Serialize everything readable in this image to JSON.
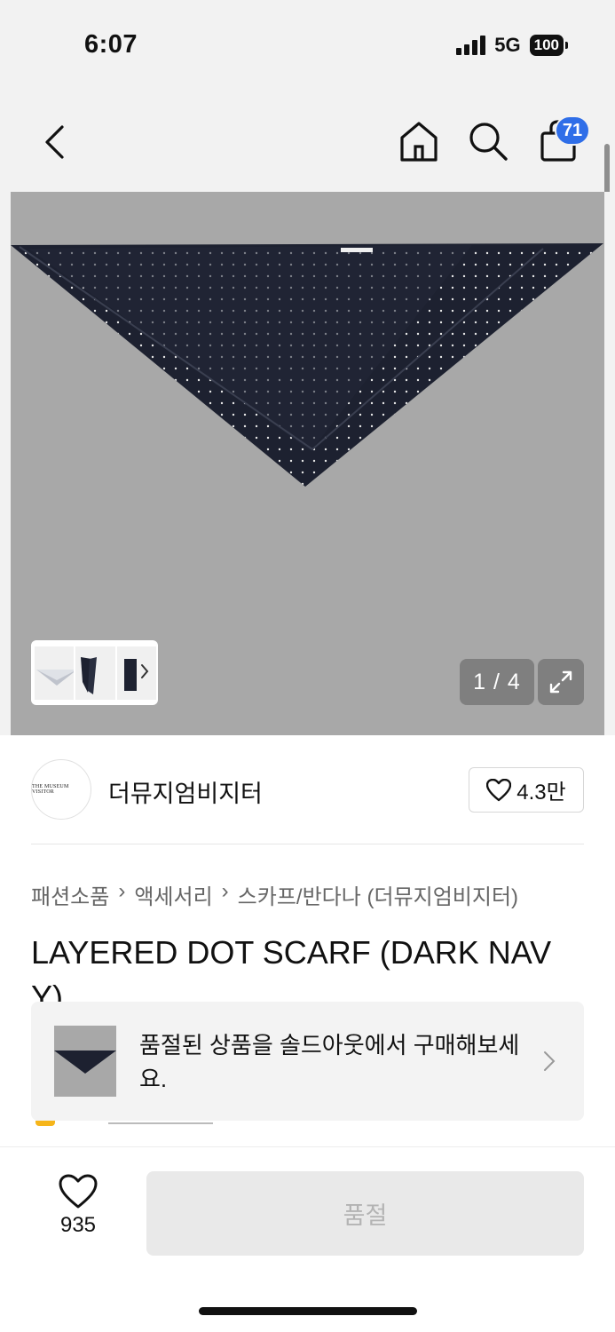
{
  "status_bar": {
    "time": "6:07",
    "network": "5G",
    "battery": "100"
  },
  "nav": {
    "cart_count": "71"
  },
  "gallery": {
    "counter": "1 / 4",
    "thumbnails": [
      "scarf-flat",
      "scarf-tied",
      "scarf-pattern"
    ]
  },
  "brand": {
    "logo_text": "THE MUSEUM VISITOR",
    "name": "더뮤지엄비지터",
    "likes": "4.3만"
  },
  "breadcrumb": [
    "패션소품",
    "액세서리",
    "스카프/반다나 (더뮤지엄비지터)"
  ],
  "product": {
    "title": "LAYERED DOT SCARF (DARK NAVY)"
  },
  "soldout_banner": {
    "text": "품절된 상품을 솔드아웃에서 구매해보세요."
  },
  "bottom_bar": {
    "wish_count": "935",
    "buy_label": "품절"
  },
  "colors": {
    "accent": "#2f6ee8",
    "scarf": "#1d2130",
    "hero_bg": "#a8a8a8"
  }
}
